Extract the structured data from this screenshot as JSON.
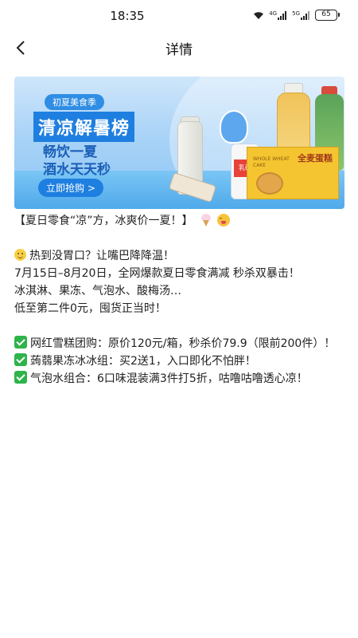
{
  "status_bar": {
    "time": "18:35",
    "network_1": "4G",
    "network_2": "5G",
    "battery": "65"
  },
  "nav": {
    "title": "详情"
  },
  "banner": {
    "tag": "初夏美食季",
    "title": "清凉解暑榜",
    "line1": "畅饮一夏",
    "line2": "酒水天天秒",
    "button": "立即抢购 >",
    "product_label_milk": "乳矿",
    "product_label_cake_en": "WHOLE WHEAT CAKE",
    "product_label_cake": "全麦蛋糕"
  },
  "content": {
    "headline": "【夏日零食“凉”方，冰爽价一夏！】",
    "intro_1": "热到没胃口？让嘴巴降降温！",
    "intro_2": "7月15日–8月20日，全网爆款夏日零食满减 秒杀双暴击！",
    "intro_3": "冰淇淋、果冻、气泡水、酸梅汤…",
    "intro_4": "低至第二件0元，囤货正当时！",
    "deal_1": "网红雪糕团购：原价120元/箱，秒杀价79.9（限前200件）！",
    "deal_2": "蒟蒻果冻冰冰组：买2送1，入口即化不怕胖！",
    "deal_3": "气泡水组合：6口味混装满3件打5折，咕噜咕噜透心凉！"
  }
}
